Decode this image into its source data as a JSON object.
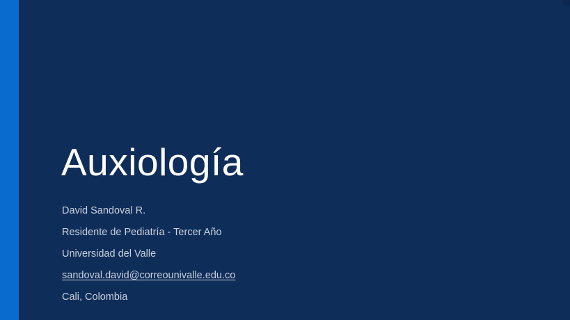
{
  "slide": {
    "title": "Auxiología",
    "author_name": "David Sandoval R.",
    "role": "Residente de Pediatría - Tercer Año",
    "institution": "Universidad del Valle",
    "email": "sandoval.david@correounivalle.edu.co",
    "location": "Cali, Colombia"
  },
  "colors": {
    "background": "#0f2d59",
    "accent_bar": "#0a6bcf",
    "title_text": "#ffffff",
    "body_text": "#c9d1de"
  }
}
